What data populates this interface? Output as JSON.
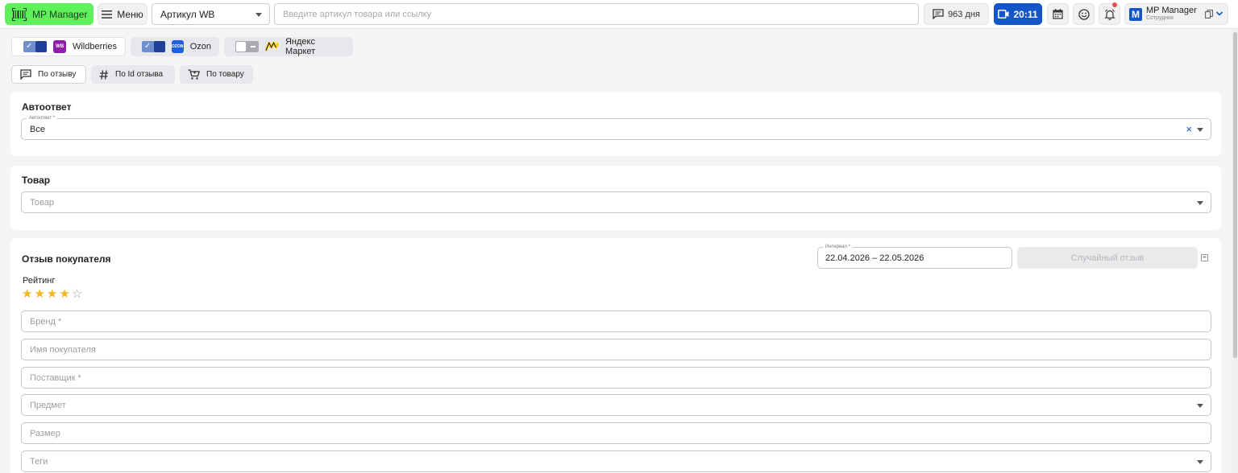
{
  "topbar": {
    "logo_label": "MP Manager",
    "menu_label": "Меню",
    "article_select_value": "Артикул WB",
    "search_placeholder": "Введите артикул товара или ссылку",
    "days_label": "963 дня",
    "time_label": "20:11",
    "user": {
      "avatar_letter": "M",
      "name": "MP Manager",
      "role": "Сотрудник"
    }
  },
  "marketplaces": [
    {
      "name": "Wildberries",
      "logo_text": "WB",
      "enabled": true
    },
    {
      "name": "Ozon",
      "logo_text": "OZON",
      "enabled": true
    },
    {
      "name": "Яндекс Маркет",
      "logo_text": "",
      "enabled": false
    }
  ],
  "search_modes": [
    {
      "label": "По отзыву",
      "active": true
    },
    {
      "label": "По Id отзыва",
      "active": false
    },
    {
      "label": "По товару",
      "active": false
    }
  ],
  "autoanswer": {
    "title": "Автоответ",
    "legend": "Автоответ *",
    "value": "Все"
  },
  "product": {
    "title": "Товар",
    "placeholder": "Товар"
  },
  "review": {
    "title": "Отзыв покупателя",
    "interval_legend": "Интервал *",
    "interval_value": "22.04.2026 – 22.05.2026",
    "random_button": "Случайный отзыв",
    "rating_label": "Рейтинг",
    "rating": 4,
    "rating_max": 5,
    "fields": {
      "brand": "Бренд *",
      "buyer_name": "Имя покупателя",
      "supplier": "Поставщик *",
      "subject": "Предмет",
      "size": "Размер",
      "tags": "Теги"
    }
  },
  "colors": {
    "logo_green": "#5ff15c",
    "primary_blue": "#1456c8",
    "star_gold": "#f2b51c",
    "wildberries": "#8e1fa8",
    "ozon": "#1f5fe0",
    "yandex": "#ffcc00"
  }
}
